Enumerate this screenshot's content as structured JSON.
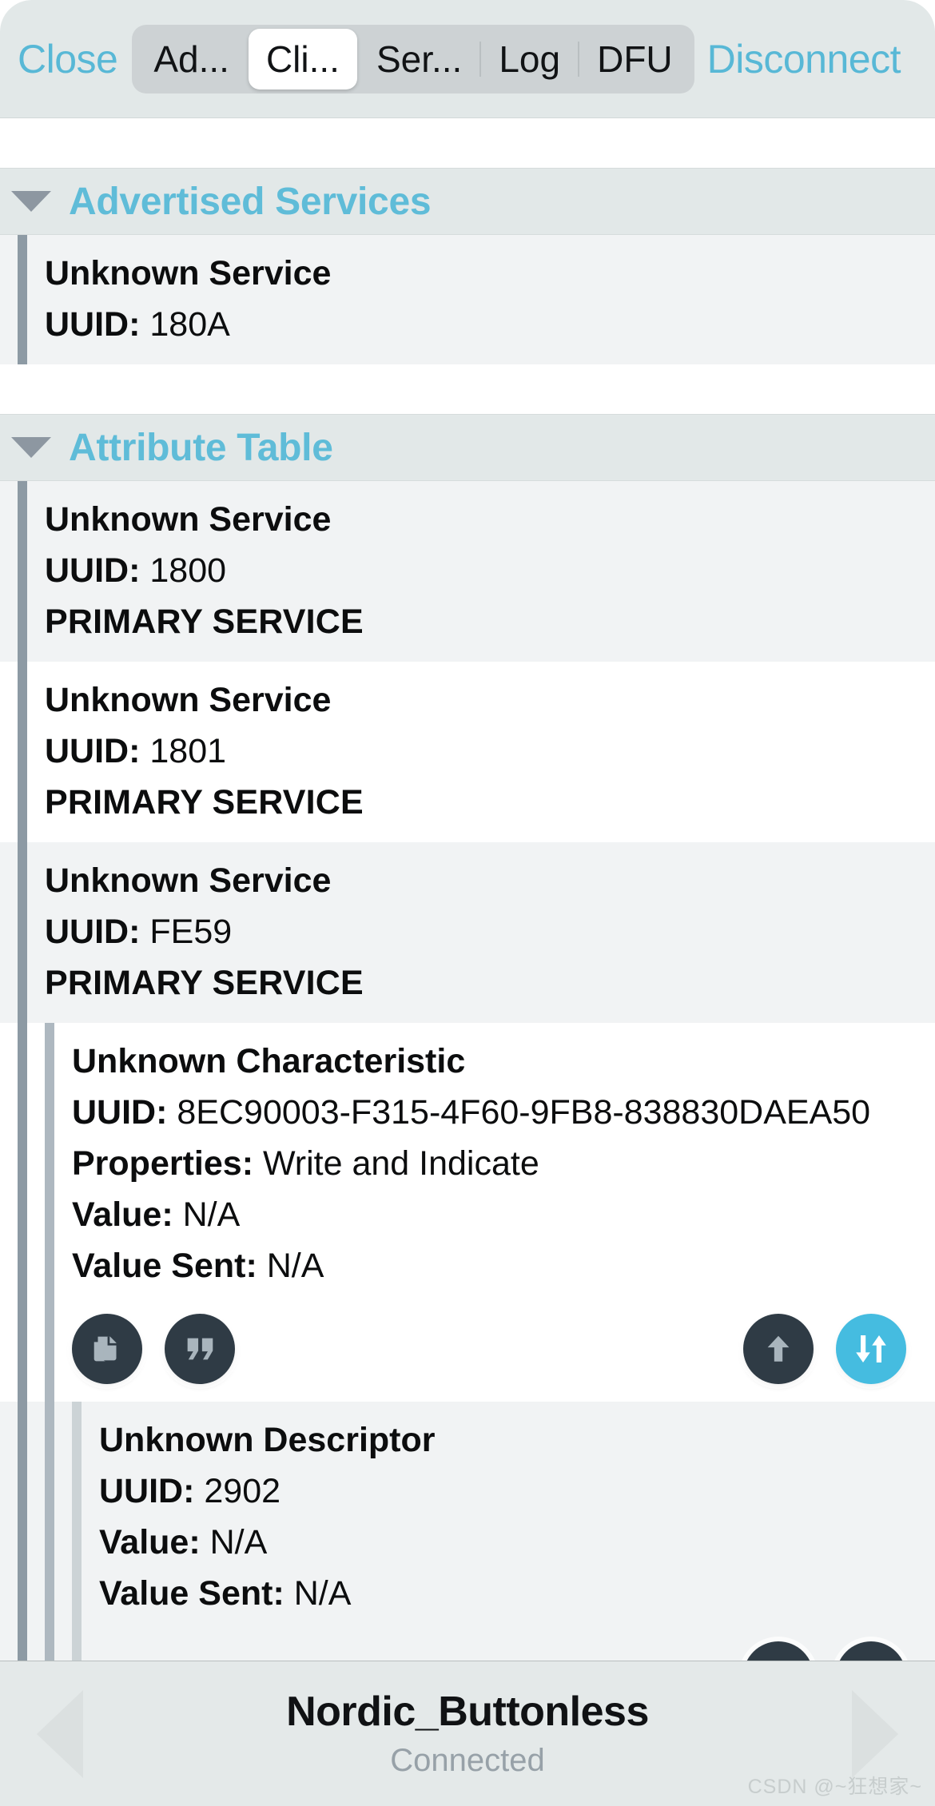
{
  "navbar": {
    "close_label": "Close",
    "disconnect_label": "Disconnect",
    "segments": [
      {
        "label": "Ad...",
        "selected": false
      },
      {
        "label": "Cli...",
        "selected": true
      },
      {
        "label": "Ser...",
        "selected": false
      },
      {
        "label": "Log",
        "selected": false
      },
      {
        "label": "DFU",
        "selected": false
      }
    ]
  },
  "sections": [
    {
      "title": "Advertised Services",
      "expanded_icon": "chevron-down-triangle-icon"
    },
    {
      "title": "Attribute Table",
      "expanded_icon": "chevron-down-triangle-icon"
    }
  ],
  "advertised_services": [
    {
      "name": "Unknown Service",
      "uuid_label": "UUID:",
      "uuid": "180A"
    }
  ],
  "attribute_table": {
    "services": [
      {
        "name": "Unknown Service",
        "uuid_label": "UUID:",
        "uuid": "1800",
        "type": "PRIMARY SERVICE"
      },
      {
        "name": "Unknown Service",
        "uuid_label": "UUID:",
        "uuid": "1801",
        "type": "PRIMARY SERVICE"
      },
      {
        "name": "Unknown Service",
        "uuid_label": "UUID:",
        "uuid": "FE59",
        "type": "PRIMARY SERVICE"
      }
    ],
    "characteristic": {
      "name": "Unknown Characteristic",
      "uuid_label": "UUID:",
      "uuid": "8EC90003-F315-4F60-9FB8-838830DAEA50",
      "properties_label": "Properties:",
      "properties": "Write and Indicate",
      "value_label": "Value:",
      "value": "N/A",
      "value_sent_label": "Value Sent:",
      "value_sent": "N/A",
      "actions": [
        {
          "icon": "copy-document-icon",
          "style": "dark"
        },
        {
          "icon": "quote-marks-icon",
          "style": "dark"
        },
        {
          "icon": "arrow-up-icon",
          "style": "dark"
        },
        {
          "icon": "arrow-up-down-icon",
          "style": "accent"
        }
      ]
    },
    "descriptor": {
      "name": "Unknown Descriptor",
      "uuid_label": "UUID:",
      "uuid": "2902",
      "value_label": "Value:",
      "value": "N/A",
      "value_sent_label": "Value Sent:",
      "value_sent": "N/A",
      "actions": [
        {
          "icon": "arrow-down-icon",
          "style": "dark"
        },
        {
          "icon": "arrow-up-icon",
          "style": "dark"
        }
      ]
    }
  },
  "bottombar": {
    "prev_icon": "triangle-left-icon",
    "next_icon": "triangle-right-icon",
    "device_name": "Nordic_Buttonless",
    "status": "Connected"
  },
  "watermark": "CSDN @~狂想家~",
  "colors": {
    "accent_blue": "#58b8d6",
    "section_title": "#5fbcd8",
    "navbar_bg": "#e2e8e8",
    "button_dark": "#2f3b45",
    "button_accent": "#45bce0"
  }
}
